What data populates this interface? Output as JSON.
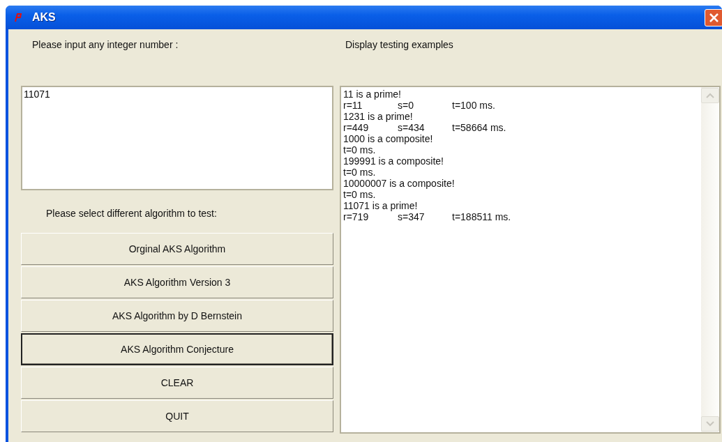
{
  "window": {
    "title": "AKS"
  },
  "input": {
    "label": "Please input any integer number :",
    "value": "11071"
  },
  "algorithm_label": "Please select different algorithm to test:",
  "buttons": [
    {
      "label": "Orginal AKS Algorithm",
      "focused": false
    },
    {
      "label": "AKS Algorithm Version 3",
      "focused": false
    },
    {
      "label": "AKS Algorithm by D Bernstein",
      "focused": false
    },
    {
      "label": "AKS Algorithm Conjecture",
      "focused": true
    },
    {
      "label": "CLEAR",
      "focused": false
    },
    {
      "label": "QUIT",
      "focused": false
    }
  ],
  "output": {
    "label": "Display testing examples",
    "lines": [
      [
        "11 is a prime!"
      ],
      [
        "r=11",
        "s=0",
        "t=100 ms."
      ],
      [
        "1231 is a prime!"
      ],
      [
        "r=449",
        "s=434",
        "t=58664 ms."
      ],
      [
        "1000 is a composite!"
      ],
      [
        "t=0 ms."
      ],
      [
        "199991 is a composite!"
      ],
      [
        "t=0 ms."
      ],
      [
        "10000007 is a composite!"
      ],
      [
        "t=0 ms."
      ],
      [
        "11071 is a prime!"
      ],
      [
        "r=719",
        "s=347",
        "t=188511 ms."
      ]
    ]
  }
}
